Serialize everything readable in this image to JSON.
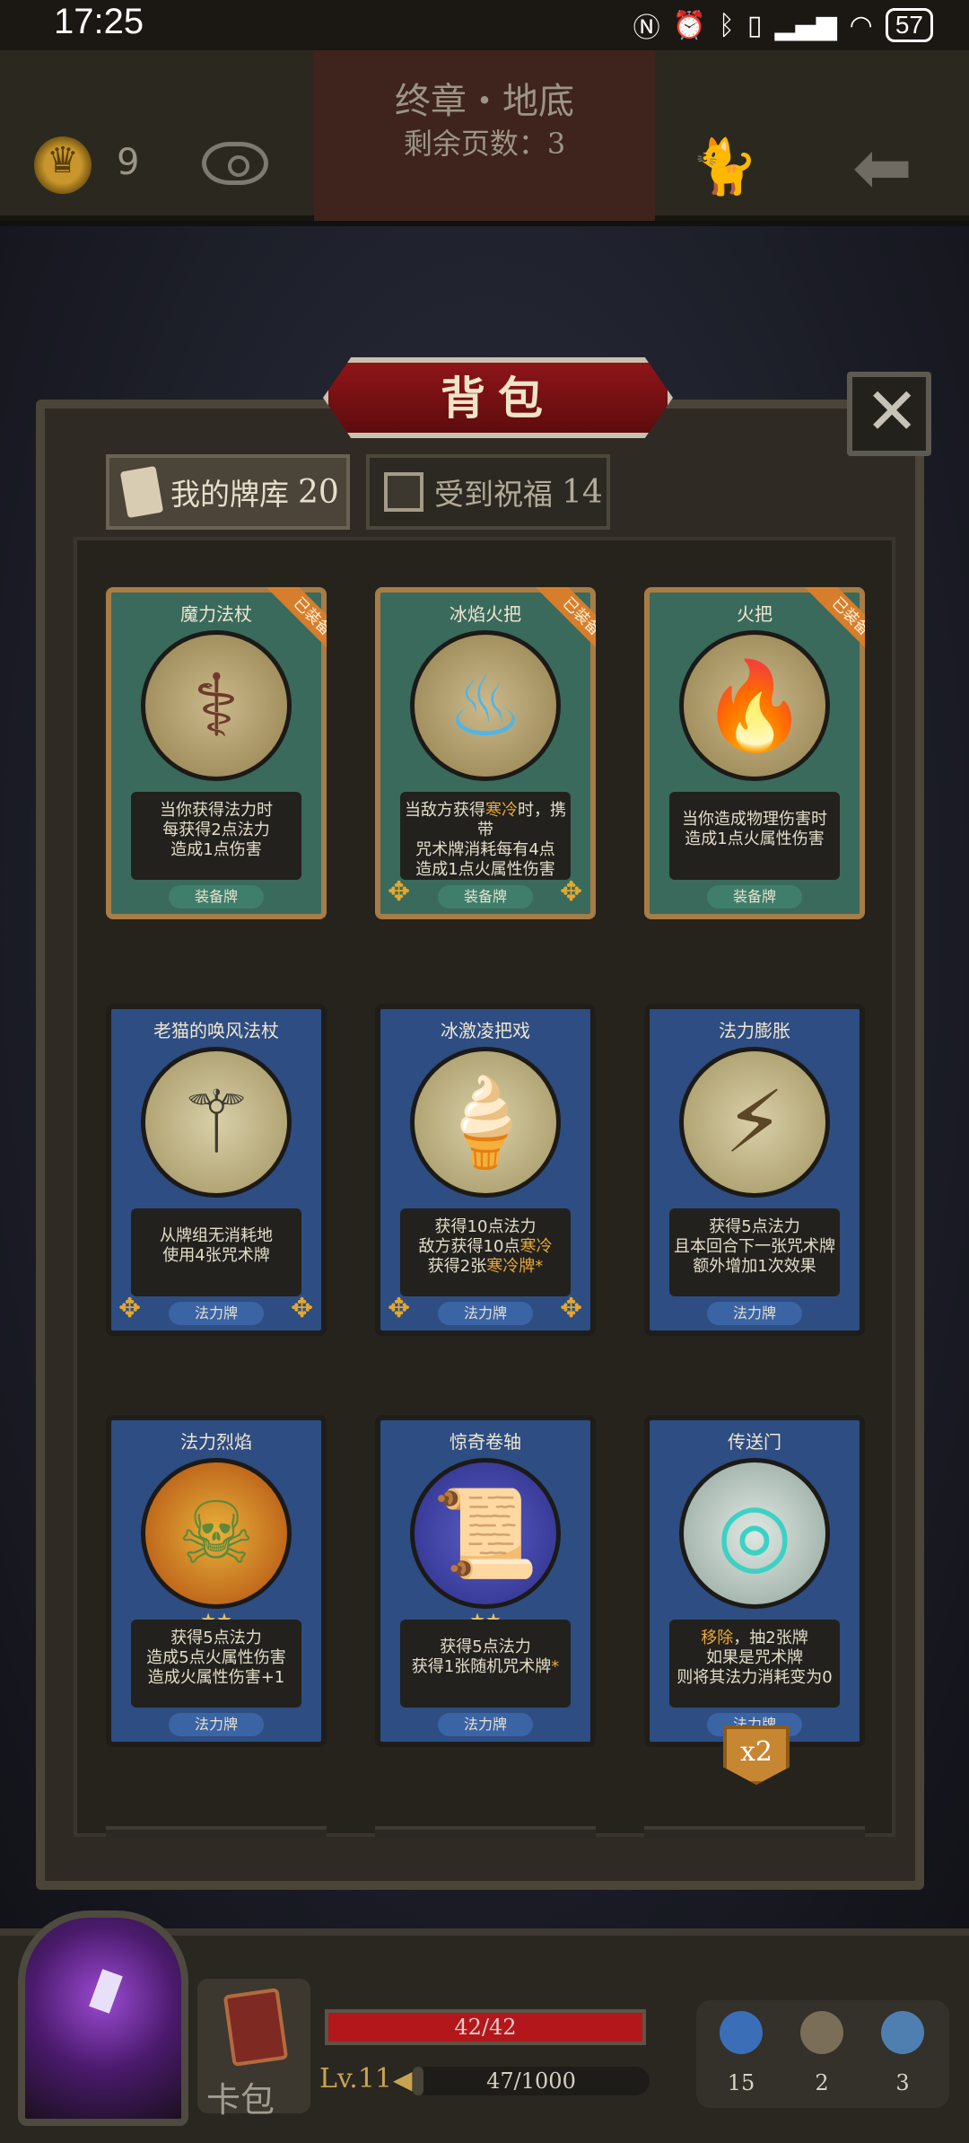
{
  "status_bar": {
    "time": "17:25",
    "icons": [
      "nfc-icon",
      "alarm-icon",
      "bluetooth-icon",
      "vibrate-icon",
      "signal-icon",
      "wifi-icon"
    ],
    "battery": "57"
  },
  "hud": {
    "chapter_title": "终章・地底",
    "pages_remaining": "剩余页数：3",
    "coins": "9"
  },
  "panel": {
    "title": "背包",
    "tabs": [
      {
        "label": "我的牌库",
        "count": "20",
        "active": true
      },
      {
        "label": "受到祝福",
        "count": "14",
        "active": false
      }
    ]
  },
  "cards": [
    {
      "name": "魔力法杖",
      "desc": "当你获得法力时\n每获得2点法力\n造成1点伤害",
      "type": "装备牌",
      "equipped_label": "已装备",
      "kind": "equip",
      "art": "staff-icon"
    },
    {
      "name": "冰焰火把",
      "desc": "当敌方获得寒冷时，携带\n咒术牌消耗每有4点\n造成1点火属性伤害",
      "type": "装备牌",
      "equipped_label": "已装备",
      "kind": "equip",
      "art": "ice-torch-icon"
    },
    {
      "name": "火把",
      "desc": "当你造成物理伤害时\n造成1点火属性伤害",
      "type": "装备牌",
      "equipped_label": "已装备",
      "kind": "equip",
      "art": "torch-icon"
    },
    {
      "name": "老猫的唤风法杖",
      "desc": "从牌组无消耗地\n使用4张咒术牌",
      "type": "法力牌",
      "kind": "spell",
      "art": "wind-staff-icon"
    },
    {
      "name": "冰激凌把戏",
      "desc": "获得10点法力\n敌方获得10点寒冷\n获得2张寒冷牌*",
      "type": "法力牌",
      "kind": "spell",
      "art": "ice-cream-icon"
    },
    {
      "name": "法力膨胀",
      "desc": "获得5点法力\n且本回合下一张咒术牌\n额外增加1次效果",
      "type": "法力牌",
      "kind": "spell",
      "art": "lightning-mage-icon"
    },
    {
      "name": "法力烈焰",
      "desc": "获得5点法力\n造成5点火属性伤害\n造成火属性伤害+1",
      "type": "法力牌",
      "kind": "spell",
      "art": "flame-zombie-icon",
      "stars": "★★"
    },
    {
      "name": "惊奇卷轴",
      "desc": "获得5点法力\n获得1张随机咒术牌*",
      "type": "法力牌",
      "kind": "spell",
      "art": "scroll-icon",
      "stars": "★★"
    },
    {
      "name": "传送门",
      "desc": "移除，抽2张牌\n如果是咒术牌\n则将其法力消耗变为0",
      "type": "法力牌",
      "kind": "spell",
      "art": "portal-icon",
      "badge": "x2"
    }
  ],
  "bottom": {
    "cardbag_label": "卡包",
    "hp_text": "42/42",
    "hp_fraction": 1.0,
    "level": "Lv.11",
    "xp_text": "47/1000",
    "xp_fraction": 0.047,
    "resources": [
      {
        "icon": "potion-icon",
        "count": "15",
        "color": "#3a6fb8"
      },
      {
        "icon": "hourglass-icon",
        "count": "2",
        "color": "#7a6e58"
      },
      {
        "icon": "cards-icon",
        "count": "3",
        "color": "#4e7fb0"
      }
    ]
  },
  "colors": {
    "equip_card": "#3a6a5c",
    "spell_card": "#2e4d82",
    "title_red": "#8e1518",
    "highlight": "#e7a93a",
    "hp_red": "#b3171c"
  }
}
